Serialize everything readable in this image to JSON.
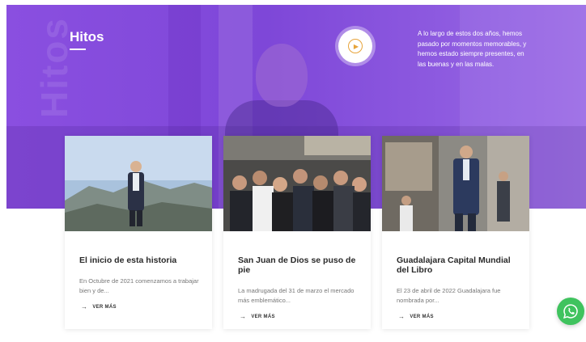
{
  "hero": {
    "title": "Hitos",
    "watermark": "Hitos",
    "description": "A lo largo de estos dos años, hemos pasado por momentos memorables, y hemos estado siempre presentes, en las buenas y en las malas.",
    "accent_color": "#8a4fe0",
    "play_icon": "play-circle-icon"
  },
  "cards": [
    {
      "title": "El inicio de esta historia",
      "excerpt": "En Octubre de 2021 comenzamos a trabajar bien y de...",
      "more_label": "VER MÁS"
    },
    {
      "title": "San Juan de Dios se puso de pie",
      "excerpt": "La madrugada del 31 de marzo el mercado más emblemático...",
      "more_label": "VER MÁS"
    },
    {
      "title": "Guadalajara Capital Mundial del Libro",
      "excerpt": "El 23 de abril de 2022 Guadalajara fue nombrada por...",
      "more_label": "VER MÁS"
    }
  ],
  "whatsapp": {
    "icon": "whatsapp-icon",
    "color": "#3fc35e"
  }
}
